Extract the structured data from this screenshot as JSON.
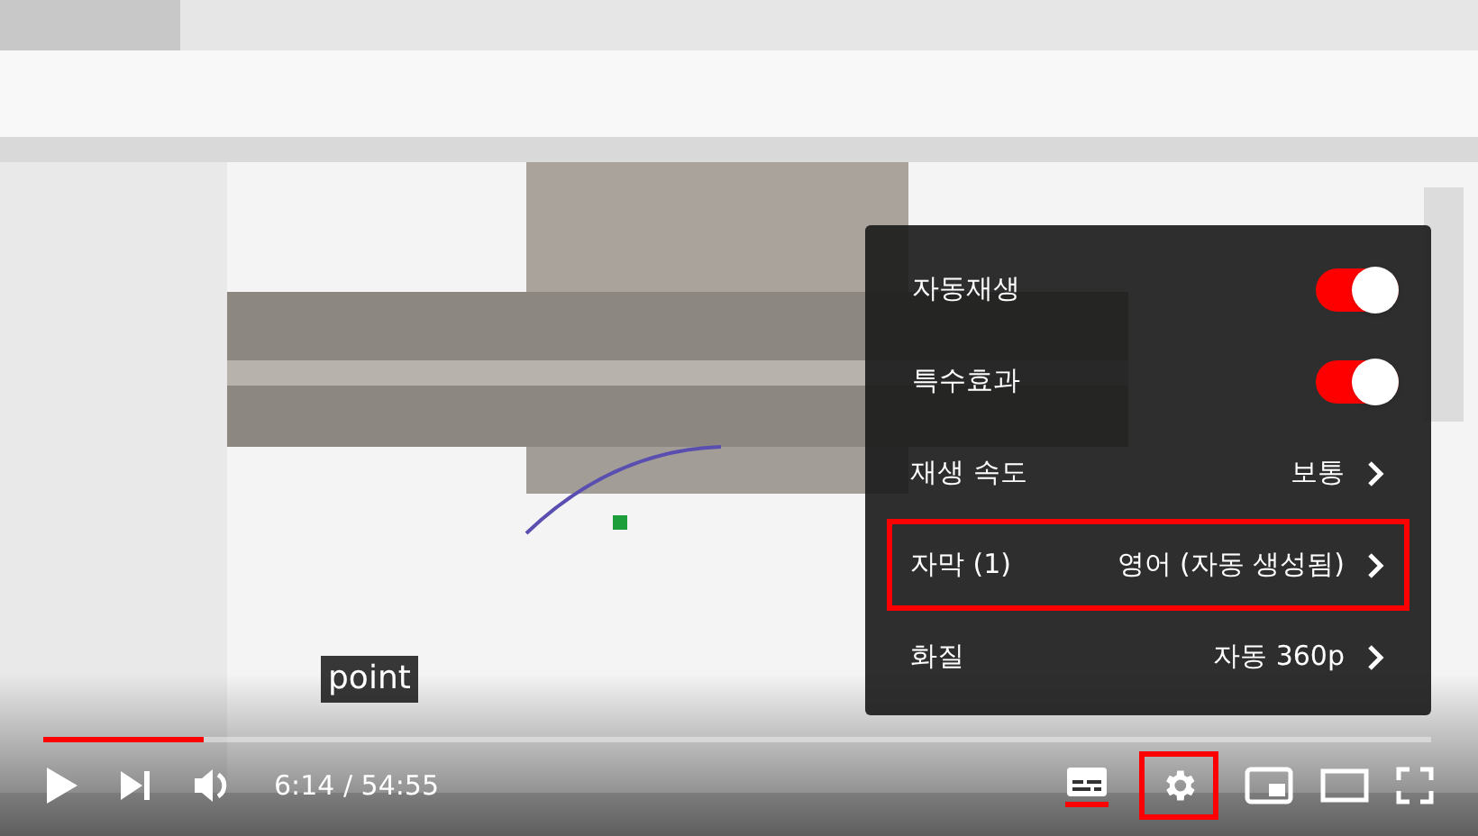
{
  "menu": {
    "items": [
      {
        "kind": "toggle",
        "label": "자동재생",
        "on": true
      },
      {
        "kind": "toggle",
        "label": "특수효과",
        "on": true
      },
      {
        "kind": "submenu",
        "label": "재생 속도",
        "value": "보통",
        "highlighted": false
      },
      {
        "kind": "submenu",
        "label": "자막 (1)",
        "value": "영어 (자동 생성됨)",
        "highlighted": true
      },
      {
        "kind": "submenu",
        "label": "화질",
        "value": "자동 360p",
        "highlighted": false
      }
    ]
  },
  "caption": "point",
  "progress": {
    "level": 0.115
  },
  "time": "6:14 / 54:55",
  "controls": {
    "subtitles_on": true,
    "settings_highlighted": true
  }
}
